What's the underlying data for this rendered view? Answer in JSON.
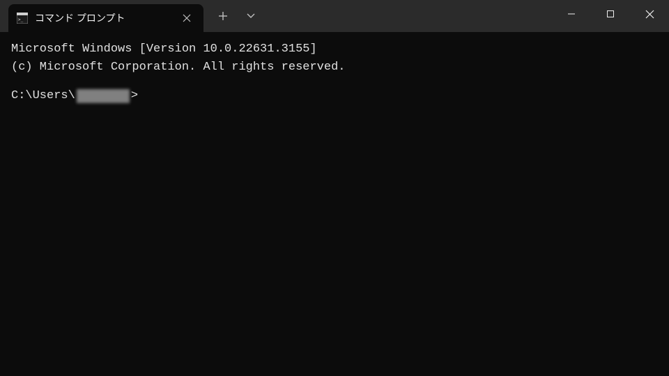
{
  "tab": {
    "title": "コマンド プロンプト"
  },
  "terminal": {
    "line1": "Microsoft Windows [Version 10.0.22631.3155]",
    "line2": "(c) Microsoft Corporation. All rights reserved.",
    "prompt_prefix": "C:\\Users\\",
    "prompt_suffix": ">"
  }
}
